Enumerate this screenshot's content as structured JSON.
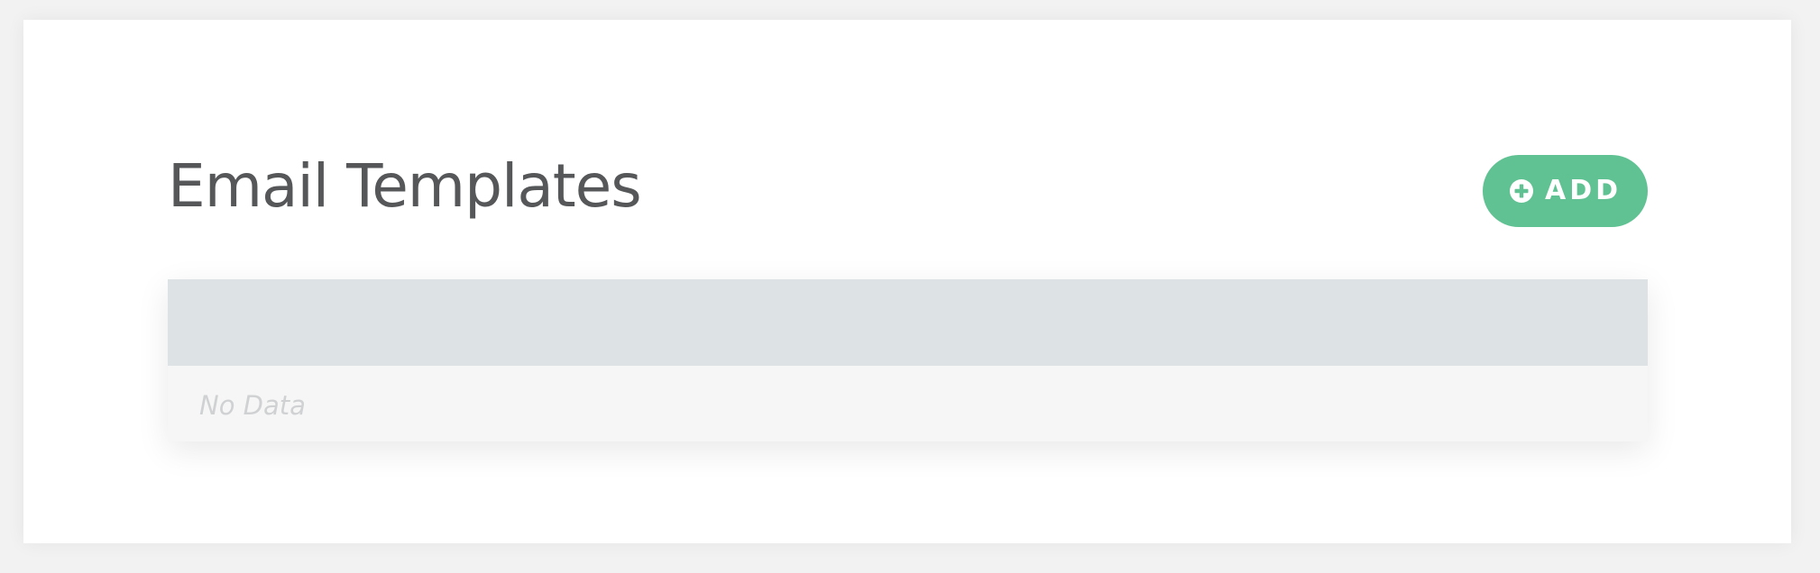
{
  "page": {
    "title": "Email Templates"
  },
  "toolbar": {
    "add_label": "ADD",
    "add_icon": "plus-circle-icon"
  },
  "table": {
    "columns": [],
    "rows": [],
    "empty_text": "No Data"
  },
  "colors": {
    "accent": "#60c293",
    "header_bg": "#dde2e5",
    "body_bg": "#f6f6f6",
    "title": "#555759",
    "empty_text": "#cfd1d3"
  }
}
